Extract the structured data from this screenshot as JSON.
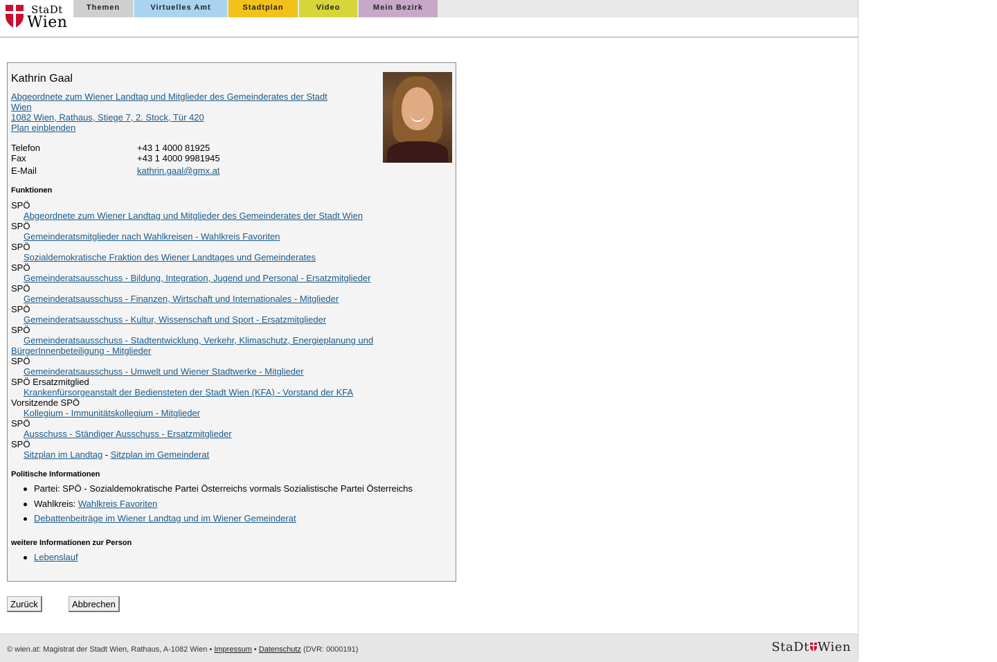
{
  "brand": {
    "line1": "StaDt",
    "line2": "Wien",
    "footer_logo_left": "StaDt",
    "footer_logo_right": "Wien"
  },
  "colors": {
    "brand_red": "#c8102e",
    "link": "#1a5a8a",
    "card_bg": "#f4f4f4"
  },
  "nav": {
    "tabs": [
      {
        "label": "Themen",
        "color": "#cfcfcf"
      },
      {
        "label": "Virtuelles Amt",
        "color": "#a8d4f0"
      },
      {
        "label": "Stadtplan",
        "color": "#f2c21a"
      },
      {
        "label": "Video",
        "color": "#d6d63a"
      },
      {
        "label": "Mein Bezirk",
        "color": "#c8a8c8"
      }
    ]
  },
  "person": {
    "name": "Kathrin Gaal",
    "title_link_line1": "Abgeordnete zum Wiener Landtag und Mitglieder des Gemeinderates der Stadt",
    "title_link_line2": "Wien",
    "address": "1082 Wien, Rathaus, Stiege 7, 2. Stock, Tür 420",
    "plan_link": "Plan einblenden",
    "contact": [
      {
        "label": "Telefon",
        "value": "+43 1 4000 81925"
      },
      {
        "label": "Fax",
        "value": "+43 1 4000 9981945"
      },
      {
        "label": "E-Mail",
        "value": "kathrin.gaal@gmx.at"
      }
    ]
  },
  "functions": {
    "heading": "Funktionen",
    "items": [
      {
        "party": "SPÖ",
        "link": "Abgeordnete zum Wiener Landtag und Mitglieder des Gemeinderates der Stadt Wien"
      },
      {
        "party": "SPÖ",
        "link": "Gemeinderatsmitglieder nach Wahlkreisen - Wahlkreis Favoriten"
      },
      {
        "party": "SPÖ",
        "link": "Sozialdemokratische Fraktion des Wiener Landtages und Gemeinderates"
      },
      {
        "party": "SPÖ",
        "link": "Gemeinderatsausschuss - Bildung, Integration, Jugend und Personal - Ersatzmitglieder"
      },
      {
        "party": "SPÖ",
        "link": "Gemeinderatsausschuss - Finanzen, Wirtschaft und Internationales - Mitglieder"
      },
      {
        "party": "SPÖ",
        "link": "Gemeinderatsausschuss - Kultur, Wissenschaft und Sport - Ersatzmitglieder"
      },
      {
        "party": "SPÖ",
        "link": "Gemeinderatsausschuss - Stadtentwicklung, Verkehr, Klimaschutz, Energieplanung und",
        "link_cont": "BürgerInnenbeteiligung - Mitglieder"
      },
      {
        "party": "SPÖ",
        "link": "Gemeinderatsausschuss - Umwelt und Wiener Stadtwerke - Mitglieder"
      },
      {
        "party": "SPÖ Ersatzmitglied",
        "link": "Krankenfürsorgeanstalt der Bediensteten der Stadt Wien (KFA) - Vorstand der KFA"
      },
      {
        "party": "Vorsitzende SPÖ",
        "link": "Kollegium - Immunitätskollegium - Mitglieder"
      },
      {
        "party": "SPÖ",
        "link": "Ausschuss - Ständiger Ausschuss - Ersatzmitglieder"
      },
      {
        "party": "SPÖ",
        "link": "Sitzplan im Landtag",
        "sep": " - ",
        "link2": "Sitzplan im Gemeinderat"
      }
    ]
  },
  "political": {
    "heading": "Politische Informationen",
    "party_text": "Partei: SPÖ - Sozialdemokratische Partei Österreichs vormals Sozialistische Partei Österreichs",
    "wahlkreis_label": "Wahlkreis:",
    "wahlkreis_link": "Wahlkreis Favoriten",
    "debate_link": "Debattenbeiträge im Wiener Landtag und im Wiener Gemeinderat"
  },
  "more": {
    "heading": "weitere Informationen zur Person",
    "lebenslauf": "Lebenslauf"
  },
  "buttons": {
    "back": "Zurück",
    "cancel": "Abbrechen"
  },
  "footer": {
    "prefix": "© wien.at: Magistrat der Stadt Wien, Rathaus, A-1082 Wien •",
    "impressum": "Impressum",
    "bullet": "•",
    "datenschutz": "Datenschutz",
    "dvr": "(DVR: 0000191)"
  }
}
